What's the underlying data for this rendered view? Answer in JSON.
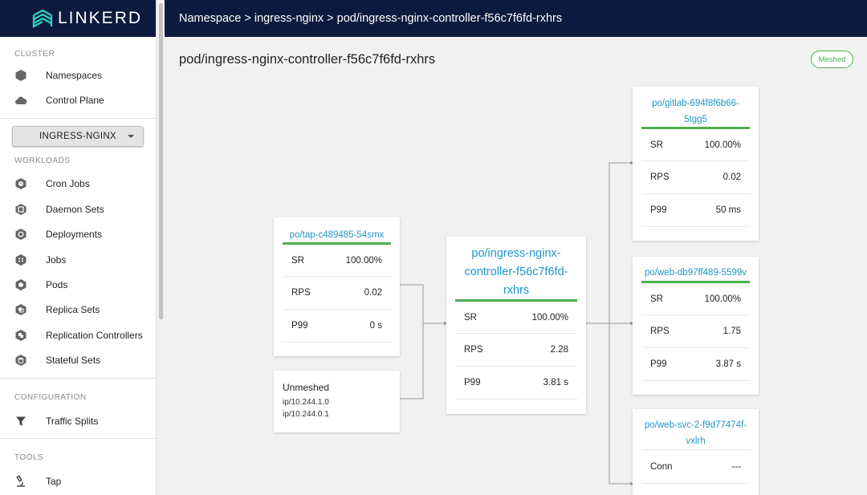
{
  "app": {
    "logo_text": "LINKERD"
  },
  "breadcrumb": {
    "text": "Namespace > ingress-nginx > pod/ingress-nginx-controller-f56c7f6fd-rxhrs"
  },
  "sidebar": {
    "cluster_label": "CLUSTER",
    "cluster_items": [
      {
        "label": "Namespaces",
        "icon": "namespace-icon"
      },
      {
        "label": "Control Plane",
        "icon": "cloud-icon"
      }
    ],
    "namespace_select": "INGRESS-NGINX",
    "workloads_label": "WORKLOADS",
    "workload_items": [
      {
        "label": "Cron Jobs",
        "icon": "cron-job-icon"
      },
      {
        "label": "Daemon Sets",
        "icon": "daemon-set-icon"
      },
      {
        "label": "Deployments",
        "icon": "deployment-icon"
      },
      {
        "label": "Jobs",
        "icon": "job-icon"
      },
      {
        "label": "Pods",
        "icon": "pod-icon"
      },
      {
        "label": "Replica Sets",
        "icon": "replica-set-icon"
      },
      {
        "label": "Replication Controllers",
        "icon": "replication-controller-icon"
      },
      {
        "label": "Stateful Sets",
        "icon": "stateful-set-icon"
      }
    ],
    "configuration_label": "CONFIGURATION",
    "configuration_items": [
      {
        "label": "Traffic Splits",
        "icon": "filter-icon"
      }
    ],
    "tools_label": "TOOLS",
    "tools_items": [
      {
        "label": "Tap",
        "icon": "microscope-icon"
      }
    ]
  },
  "main": {
    "title": "pod/ingress-nginx-controller-f56c7f6fd-rxhrs",
    "badge": "Meshed"
  },
  "graph": {
    "center": {
      "title_lines": [
        "po/ingress-nginx-",
        "controller-f56c7f6fd-",
        "rxhrs"
      ],
      "sr_label": "SR",
      "sr": "100.00%",
      "rps_label": "RPS",
      "rps": "2.28",
      "p99_label": "P99",
      "p99": "3.81 s"
    },
    "inbound": [
      {
        "title": "po/tap-c489485-54smx",
        "sr_label": "SR",
        "sr": "100.00%",
        "rps_label": "RPS",
        "rps": "0.02",
        "p99_label": "P99",
        "p99": "0 s"
      }
    ],
    "unmeshed": {
      "title": "Unmeshed",
      "ips": [
        "ip/10.244.1.0",
        "ip/10.244.0.1"
      ]
    },
    "outbound": [
      {
        "title_lines": [
          "po/gitlab-694f8f6b66-",
          "5tgg5"
        ],
        "sr_label": "SR",
        "sr": "100.00%",
        "rps_label": "RPS",
        "rps": "0.02",
        "p99_label": "P99",
        "p99": "50 ms"
      },
      {
        "title_lines": [
          "po/web-db97ff489-5599v"
        ],
        "sr_label": "SR",
        "sr": "100.00%",
        "rps_label": "RPS",
        "rps": "1.75",
        "p99_label": "P99",
        "p99": "3.87 s"
      },
      {
        "title_lines": [
          "po/web-svc-2-f9d77474f-",
          "vxlrh"
        ],
        "conn_label": "Conn",
        "conn": "---"
      }
    ]
  },
  "colors": {
    "navy": "#0c1a3d",
    "accent_green": "#4caf50",
    "link_blue": "#2196c9"
  }
}
